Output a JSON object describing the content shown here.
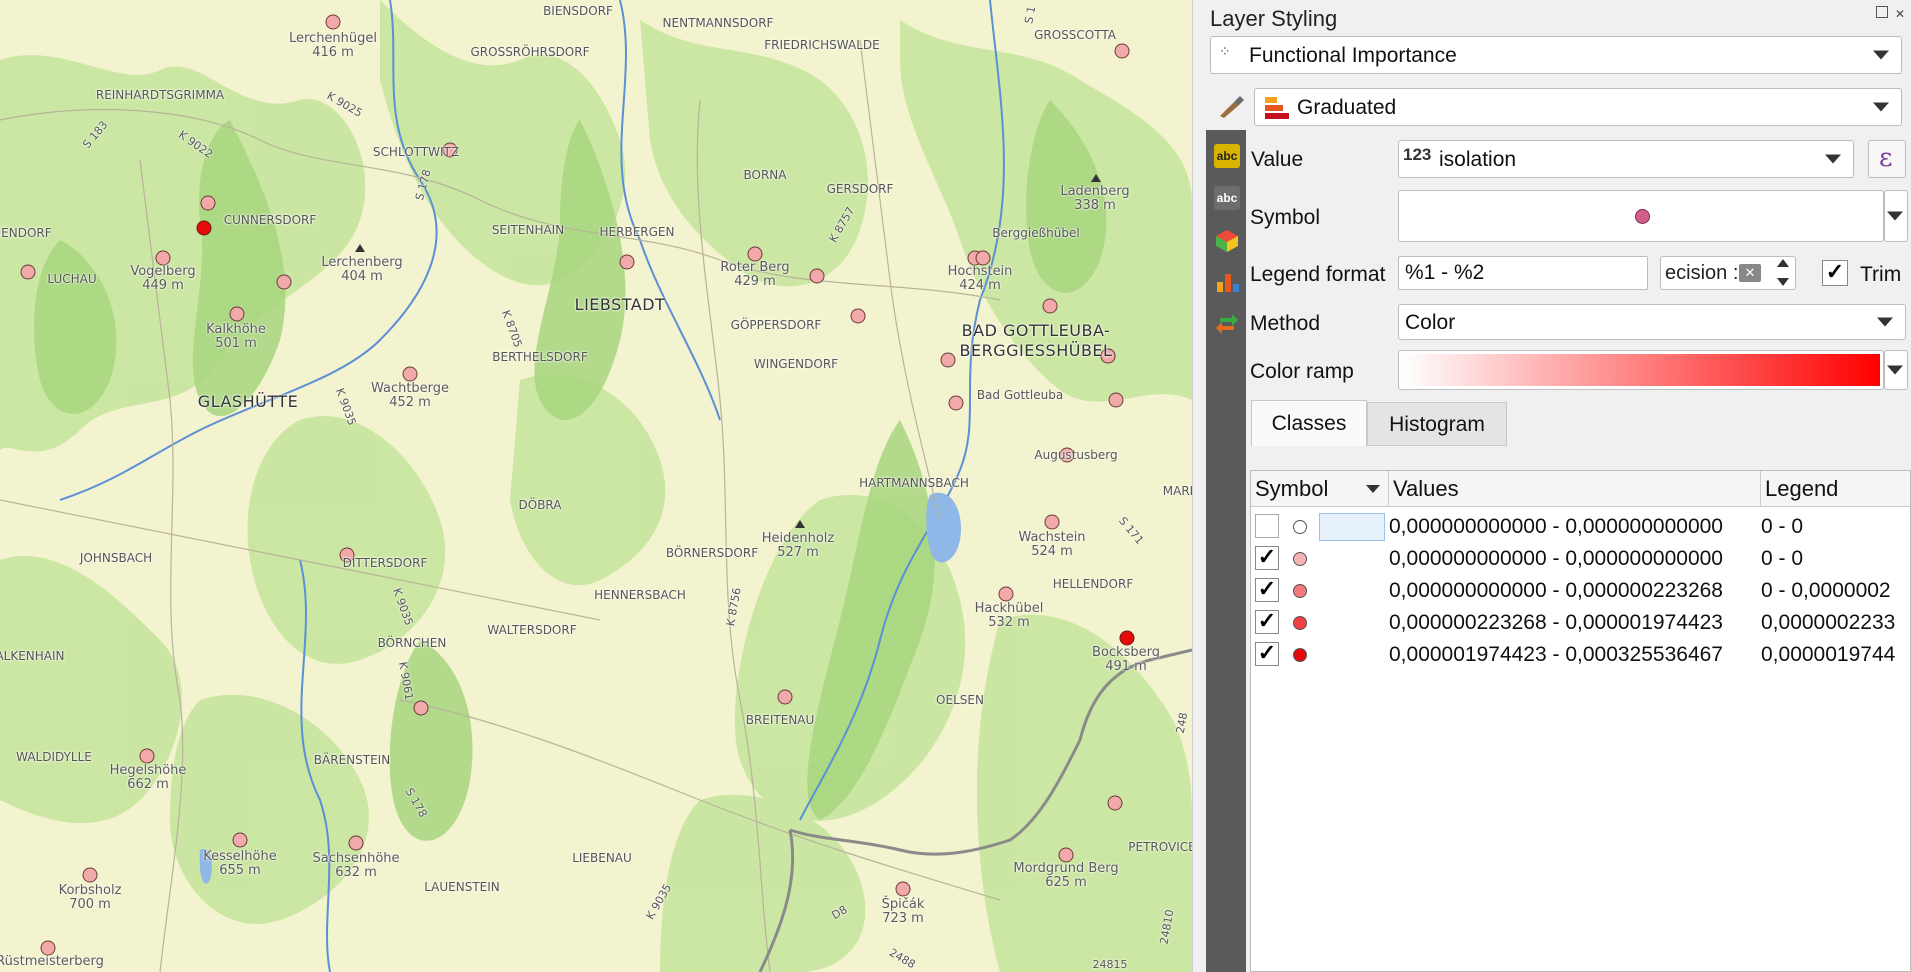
{
  "map": {
    "towns": [
      {
        "id": "liebstadt",
        "label": "LIEBSTADT"
      },
      {
        "id": "glashuette",
        "label": "GLASHÜTTE"
      },
      {
        "id": "bad-gottleuba",
        "label": "BAD GOTTLEUBA-"
      },
      {
        "id": "bad-gottleuba-2",
        "label": "BERGGIESSHÜBEL"
      }
    ],
    "villages": [
      "BIENSDORF",
      "NENTMANNSDORF",
      "GROSSCOTTA",
      "GROSSRÖHRSDORF",
      "FRIEDRICHSWALDE",
      "REINHARDTSGRIMMA",
      "SCHLOTTWITZ",
      "BORNA",
      "GERSDORF",
      "CUNNERSDORF",
      "SEITENHAIN",
      "HERBERGEN",
      "Berggießhübel",
      "LUCHAU",
      "GÖPPERSDORF",
      "BERTHELSDORF",
      "WINGENDORF",
      "Bad Gottleuba",
      "HARTMANNSBACH",
      "DÖBRA",
      "JOHNSBACH",
      "DITTERSDORF",
      "BÖRNERSDORF",
      "HENNERSBACH",
      "WALTERSDORF",
      "BÖRNCHEN",
      "HELLENDORF",
      "ALKENHAIN",
      "OELSEN",
      "BREITENAU",
      "WALDIDYLLE",
      "BÄRENSTEIN",
      "LIEBENAU",
      "LAUENSTEIN",
      "PETROVICE",
      "Augustusberg",
      "UENDORF",
      "MARI"
    ],
    "peaks": [
      {
        "name": "Lerchenhügel",
        "elev": "416 m"
      },
      {
        "name": "Vogelberg",
        "elev": "449 m"
      },
      {
        "name": "Lerchenberg",
        "elev": "404 m"
      },
      {
        "name": "Kalkhöhe",
        "elev": "501 m"
      },
      {
        "name": "Wachtberge",
        "elev": "452 m"
      },
      {
        "name": "Roter Berg",
        "elev": "429 m"
      },
      {
        "name": "Hochstein",
        "elev": "424 m"
      },
      {
        "name": "Ladenberg",
        "elev": "338 m"
      },
      {
        "name": "Heidenholz",
        "elev": "527 m"
      },
      {
        "name": "Wachstein",
        "elev": "524 m"
      },
      {
        "name": "Hackhübel",
        "elev": "532 m"
      },
      {
        "name": "Bocksberg",
        "elev": "491 m"
      },
      {
        "name": "Hegelshöhe",
        "elev": "662 m"
      },
      {
        "name": "Kesselhöhe",
        "elev": "655 m"
      },
      {
        "name": "Sachsenhöhe",
        "elev": "632 m"
      },
      {
        "name": "Korbsholz",
        "elev": "700 m"
      },
      {
        "name": "Mordgrund Berg",
        "elev": "625 m"
      },
      {
        "name": "Špičák",
        "elev": "723 m"
      },
      {
        "name": "Rüstmeisterberg",
        "elev": ""
      }
    ],
    "roads": [
      "S 183",
      "K 9022",
      "K 9025",
      "S 178",
      "K 8757",
      "K 8705",
      "K 9035",
      "K 8756",
      "K 9035",
      "K 9061",
      "S 178",
      "K 9035",
      "S 171",
      "248",
      "24810",
      "D8",
      "2488",
      "24815",
      "S 1"
    ]
  },
  "panel": {
    "title": "Layer Styling",
    "layer_name": "Functional Importance",
    "renderer": "Graduated",
    "value_label": "Value",
    "value_prefix": "123",
    "value_field": "isolation",
    "expression_icon": "ε",
    "symbol_label": "Symbol",
    "legend_format_label": "Legend format",
    "legend_format_value": "%1 - %2",
    "precision_placeholder": "ecision :",
    "trim_label": "Trim",
    "method_label": "Method",
    "method_value": "Color",
    "color_ramp_label": "Color ramp",
    "tab_classes": "Classes",
    "tab_histogram": "Histogram",
    "col_symbol": "Symbol",
    "col_values": "Values",
    "col_legend": "Legend",
    "classes": [
      {
        "checked": false,
        "color": "#ffffff",
        "values": "0,000000000000 - 0,000000000000",
        "legend": "0 - 0"
      },
      {
        "checked": true,
        "color": "#f6b3b3",
        "values": "0,000000000000 - 0,000000000000",
        "legend": "0 - 0"
      },
      {
        "checked": true,
        "color": "#f07a7a",
        "values": "0,000000000000 - 0,000000223268",
        "legend": "0 - 0,0000002"
      },
      {
        "checked": true,
        "color": "#ee4040",
        "values": "0,000000223268 - 0,000001974423",
        "legend": "0,0000002233"
      },
      {
        "checked": true,
        "color": "#e60b0b",
        "values": "0,000001974423 - 0,000325536467",
        "legend": "0,0000019744"
      }
    ]
  },
  "colors": {
    "map_base": "#f4f3cf",
    "forest": "#c4e39a",
    "forest_dark": "#9fcf78",
    "river": "#5b8fd6",
    "symbol_point": "#f2a9a9",
    "symbol_selected": "#e60b0b",
    "ramp_start": "#ffffff",
    "ramp_end": "#ff0000"
  }
}
